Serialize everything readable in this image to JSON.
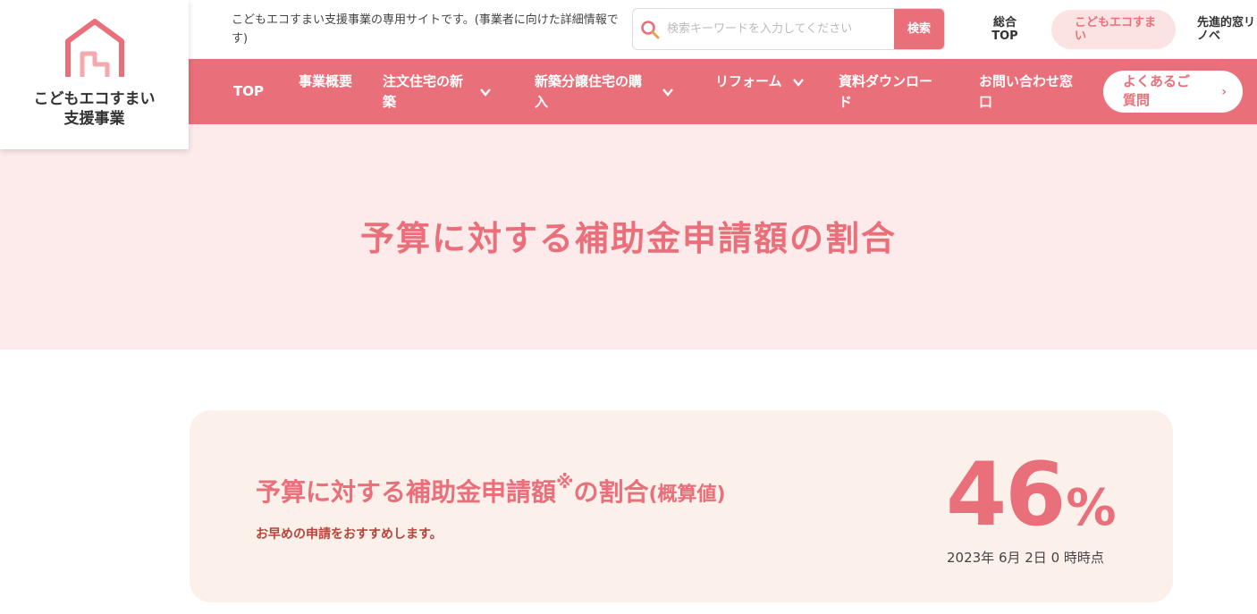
{
  "logo": {
    "line1": "こどもエコすまい",
    "line2": "支援事業",
    "icon": "house-logo-icon"
  },
  "header": {
    "tagline": "こどもエコすまい支援事業の専用サイトです。(事業者に向けた詳細情報です)",
    "search": {
      "placeholder": "検索キーワードを入力してください",
      "button_label": "検索",
      "icon": "search-icon"
    },
    "links": {
      "general": "総合TOP",
      "current": "こどもエコすまい",
      "advanced": "先進的窓リノベ"
    }
  },
  "nav": {
    "items": [
      {
        "label": "TOP"
      },
      {
        "label": "事業概要"
      },
      {
        "label": "注文住宅の新築"
      },
      {
        "label": "新築分譲住宅の購入"
      },
      {
        "label": "リフォーム"
      },
      {
        "label": "資料ダウンロード"
      },
      {
        "label": "お問い合わせ窓口"
      }
    ],
    "faq": {
      "label": "よくあるご質問"
    }
  },
  "hero": {
    "title": "予算に対する補助金申請額の割合"
  },
  "card": {
    "title_main": "予算に対する補助金申請額",
    "title_mark": "※",
    "title_suffix": "の割合",
    "title_paren": "(概算値)",
    "note": "お早めの申請をおすすめします。",
    "percent_value": "46",
    "percent_unit": "%",
    "as_of": "2023年 6月 2日 0 時時点"
  },
  "colors": {
    "accent": "#e9707a",
    "hero_bg": "#fcebea",
    "card_bg": "#fbf0ea",
    "note": "#b8443a"
  }
}
